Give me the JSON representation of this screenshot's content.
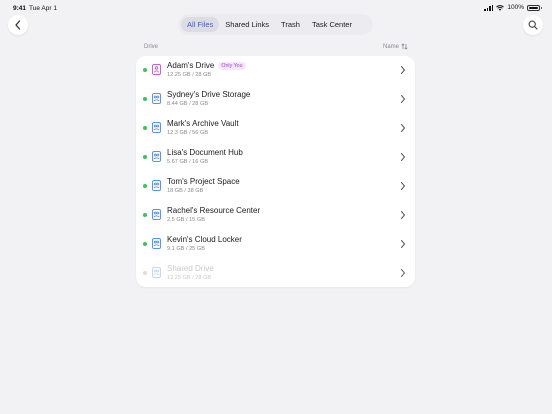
{
  "status": {
    "time": "9:41",
    "date": "Tue Apr 1",
    "battery": "100%"
  },
  "toolbar": {
    "tabs": [
      {
        "label": "All Files",
        "active": true
      },
      {
        "label": "Shared Links",
        "active": false
      },
      {
        "label": "Trash",
        "active": false
      },
      {
        "label": "Task Center",
        "active": false
      }
    ],
    "back_icon": "chevron-left-icon",
    "search_icon": "magnifier-icon"
  },
  "list": {
    "header_left": "Drive",
    "sort_label": "Name",
    "sort_icon": "sort-arrows-icon",
    "drives": [
      {
        "name": "Adam's Drive",
        "usage": "12.25 GB / 28 GB",
        "badge": "Only You",
        "status": "online",
        "icon": "personal-drive-icon"
      },
      {
        "name": "Sydney's Drive Storage",
        "usage": "8.44 GB / 28 GB",
        "badge": "",
        "status": "online",
        "icon": "shared-drive-icon"
      },
      {
        "name": "Mark's Archive Vault",
        "usage": "12.3 GB / 56 GB",
        "badge": "",
        "status": "online",
        "icon": "shared-drive-icon"
      },
      {
        "name": "Lisa's Document Hub",
        "usage": "5.67 GB / 16 GB",
        "badge": "",
        "status": "online",
        "icon": "shared-drive-icon"
      },
      {
        "name": "Tom's Project Space",
        "usage": "18 GB / 38 GB",
        "badge": "",
        "status": "online",
        "icon": "shared-drive-icon"
      },
      {
        "name": "Rachel's Resource Center",
        "usage": "2.5 GB / 15 GB",
        "badge": "",
        "status": "online",
        "icon": "shared-drive-icon"
      },
      {
        "name": "Kevin's Cloud Locker",
        "usage": "9.1 GB / 25 GB",
        "badge": "",
        "status": "online",
        "icon": "shared-drive-icon"
      },
      {
        "name": "Shared Drive",
        "usage": "12.25 GB / 28 GB",
        "badge": "",
        "status": "disabled",
        "icon": "shared-drive-icon"
      }
    ]
  },
  "colors": {
    "accent": "#3f5bd8",
    "online": "#34c759",
    "badge_text": "#a742c9",
    "badge_bg": "#f5e6fb",
    "drive_icon_blue": "#3b82f6",
    "drive_icon_purple": "#b34ad6"
  }
}
